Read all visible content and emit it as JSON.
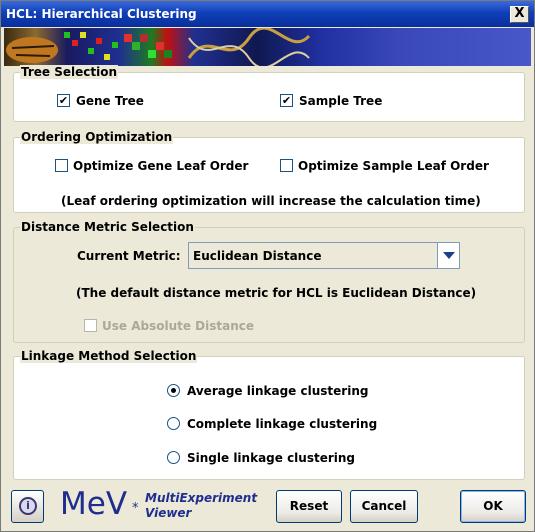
{
  "window": {
    "title": "HCL: Hierarchical Clustering",
    "close_label": "X"
  },
  "tree_selection": {
    "legend": "Tree Selection",
    "gene_tree": {
      "label": "Gene Tree",
      "checked": true
    },
    "sample_tree": {
      "label": "Sample Tree",
      "checked": true
    }
  },
  "ordering": {
    "legend": "Ordering Optimization",
    "gene_leaf": {
      "label": "Optimize Gene Leaf Order",
      "checked": false
    },
    "sample_leaf": {
      "label": "Optimize Sample Leaf Order",
      "checked": false
    },
    "note": "(Leaf ordering optimization will increase the calculation time)"
  },
  "distance": {
    "legend": "Distance Metric Selection",
    "current_label": "Current Metric:",
    "current_value": "Euclidean Distance",
    "note": "(The default distance metric for HCL is Euclidean Distance)",
    "absolute": {
      "label": "Use Absolute Distance",
      "checked": false,
      "enabled": false
    }
  },
  "linkage": {
    "legend": "Linkage Method Selection",
    "options": [
      {
        "label": "Average linkage clustering",
        "selected": true
      },
      {
        "label": "Complete linkage clustering",
        "selected": false
      },
      {
        "label": "Single linkage clustering",
        "selected": false
      }
    ]
  },
  "footer": {
    "logo_main": "MeV",
    "logo_star": "*",
    "logo_line1": "MultiExperiment",
    "logo_line2": "Viewer",
    "info_glyph": "i",
    "reset_label": "Reset",
    "cancel_label": "Cancel",
    "ok_label": "OK"
  },
  "check_glyph": "✔"
}
